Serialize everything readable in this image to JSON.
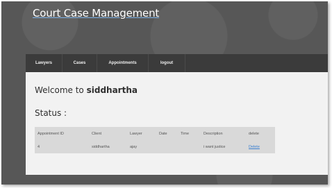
{
  "header": {
    "site_title": "Court Case Management"
  },
  "menu": {
    "items": [
      {
        "label": "Lawyers"
      },
      {
        "label": "Cases"
      },
      {
        "label": "Appointments"
      },
      {
        "label": "logout"
      }
    ]
  },
  "main": {
    "welcome_prefix": "Welcome to",
    "username": "siddhartha",
    "status_label": "Status :"
  },
  "table": {
    "headers": [
      "Appointment ID",
      "Client",
      "Lawyer",
      "Date",
      "Time",
      "Description",
      "delete"
    ],
    "rows": [
      {
        "appointment_id": "4",
        "client": "siddhartha",
        "lawyer": "ajay",
        "date": "",
        "time": "",
        "description": "i want justice",
        "delete_label": "Delete"
      }
    ]
  },
  "colors": {
    "background": "#575757",
    "menubar": "#3b3b3b",
    "content": "#f2f2f2",
    "table": "#d9d9d9",
    "link": "#3a7fd0"
  }
}
